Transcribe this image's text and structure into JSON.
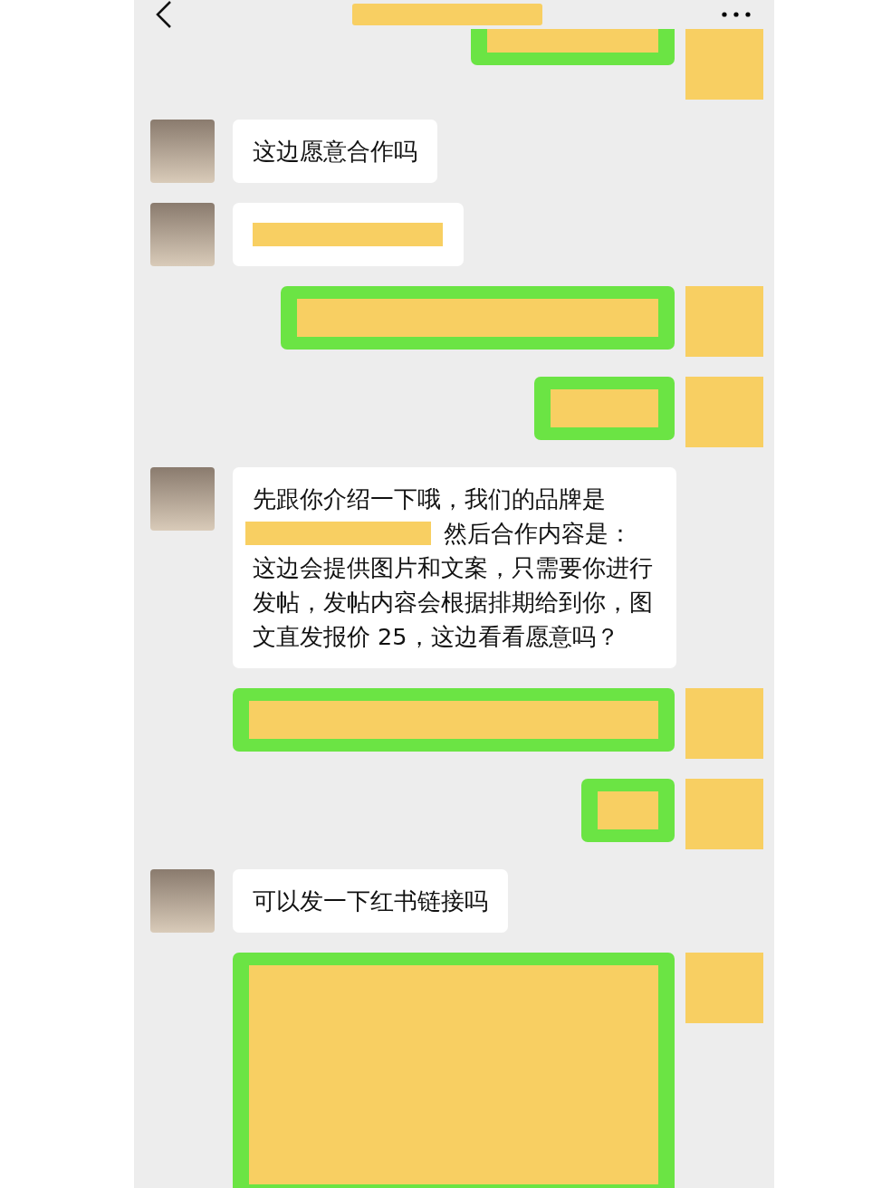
{
  "header": {
    "title_redacted": true
  },
  "messages": [
    {
      "kind": "outgoing",
      "redacted": true
    },
    {
      "kind": "incoming",
      "redacted": false,
      "text": "这边愿意合作吗"
    },
    {
      "kind": "incoming",
      "redacted": true
    },
    {
      "kind": "outgoing",
      "redacted": true
    },
    {
      "kind": "outgoing",
      "redacted": true
    },
    {
      "kind": "incoming",
      "redacted": false,
      "text": "先跟你介绍一下哦，我们的品牌是",
      "text_after": "然后合作内容是：",
      "text_rest": "这边会提供图片和文案，只需要你进行发帖，发帖内容会根据排期给到你，图文直发报价 25，这边看看愿意吗？"
    },
    {
      "kind": "outgoing",
      "redacted": true
    },
    {
      "kind": "outgoing",
      "redacted": true
    },
    {
      "kind": "incoming",
      "redacted": false,
      "text": "可以发一下红书链接吗"
    },
    {
      "kind": "outgoing",
      "redacted": true
    }
  ]
}
